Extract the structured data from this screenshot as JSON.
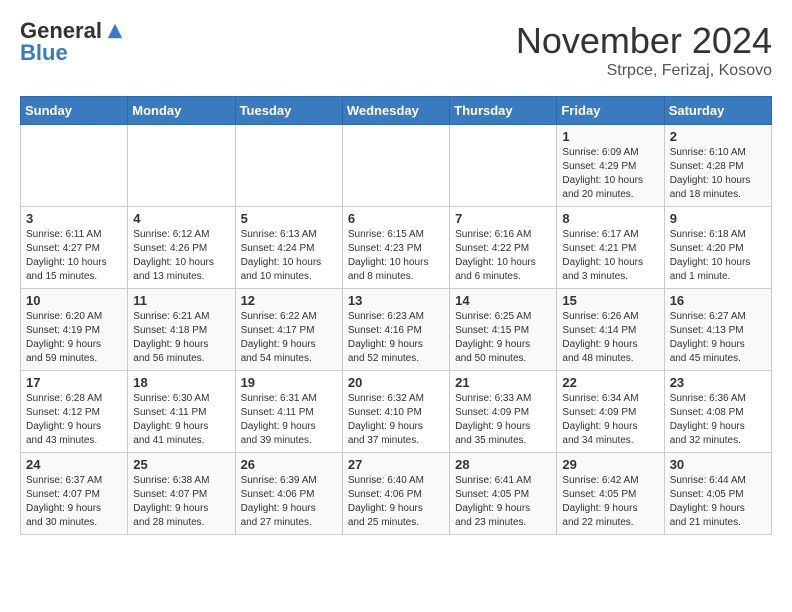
{
  "header": {
    "logo_general": "General",
    "logo_blue": "Blue",
    "month_title": "November 2024",
    "location": "Strpce, Ferizaj, Kosovo"
  },
  "weekdays": [
    "Sunday",
    "Monday",
    "Tuesday",
    "Wednesday",
    "Thursday",
    "Friday",
    "Saturday"
  ],
  "weeks": [
    [
      {
        "day": "",
        "info": ""
      },
      {
        "day": "",
        "info": ""
      },
      {
        "day": "",
        "info": ""
      },
      {
        "day": "",
        "info": ""
      },
      {
        "day": "",
        "info": ""
      },
      {
        "day": "1",
        "info": "Sunrise: 6:09 AM\nSunset: 4:29 PM\nDaylight: 10 hours\nand 20 minutes."
      },
      {
        "day": "2",
        "info": "Sunrise: 6:10 AM\nSunset: 4:28 PM\nDaylight: 10 hours\nand 18 minutes."
      }
    ],
    [
      {
        "day": "3",
        "info": "Sunrise: 6:11 AM\nSunset: 4:27 PM\nDaylight: 10 hours\nand 15 minutes."
      },
      {
        "day": "4",
        "info": "Sunrise: 6:12 AM\nSunset: 4:26 PM\nDaylight: 10 hours\nand 13 minutes."
      },
      {
        "day": "5",
        "info": "Sunrise: 6:13 AM\nSunset: 4:24 PM\nDaylight: 10 hours\nand 10 minutes."
      },
      {
        "day": "6",
        "info": "Sunrise: 6:15 AM\nSunset: 4:23 PM\nDaylight: 10 hours\nand 8 minutes."
      },
      {
        "day": "7",
        "info": "Sunrise: 6:16 AM\nSunset: 4:22 PM\nDaylight: 10 hours\nand 6 minutes."
      },
      {
        "day": "8",
        "info": "Sunrise: 6:17 AM\nSunset: 4:21 PM\nDaylight: 10 hours\nand 3 minutes."
      },
      {
        "day": "9",
        "info": "Sunrise: 6:18 AM\nSunset: 4:20 PM\nDaylight: 10 hours\nand 1 minute."
      }
    ],
    [
      {
        "day": "10",
        "info": "Sunrise: 6:20 AM\nSunset: 4:19 PM\nDaylight: 9 hours\nand 59 minutes."
      },
      {
        "day": "11",
        "info": "Sunrise: 6:21 AM\nSunset: 4:18 PM\nDaylight: 9 hours\nand 56 minutes."
      },
      {
        "day": "12",
        "info": "Sunrise: 6:22 AM\nSunset: 4:17 PM\nDaylight: 9 hours\nand 54 minutes."
      },
      {
        "day": "13",
        "info": "Sunrise: 6:23 AM\nSunset: 4:16 PM\nDaylight: 9 hours\nand 52 minutes."
      },
      {
        "day": "14",
        "info": "Sunrise: 6:25 AM\nSunset: 4:15 PM\nDaylight: 9 hours\nand 50 minutes."
      },
      {
        "day": "15",
        "info": "Sunrise: 6:26 AM\nSunset: 4:14 PM\nDaylight: 9 hours\nand 48 minutes."
      },
      {
        "day": "16",
        "info": "Sunrise: 6:27 AM\nSunset: 4:13 PM\nDaylight: 9 hours\nand 45 minutes."
      }
    ],
    [
      {
        "day": "17",
        "info": "Sunrise: 6:28 AM\nSunset: 4:12 PM\nDaylight: 9 hours\nand 43 minutes."
      },
      {
        "day": "18",
        "info": "Sunrise: 6:30 AM\nSunset: 4:11 PM\nDaylight: 9 hours\nand 41 minutes."
      },
      {
        "day": "19",
        "info": "Sunrise: 6:31 AM\nSunset: 4:11 PM\nDaylight: 9 hours\nand 39 minutes."
      },
      {
        "day": "20",
        "info": "Sunrise: 6:32 AM\nSunset: 4:10 PM\nDaylight: 9 hours\nand 37 minutes."
      },
      {
        "day": "21",
        "info": "Sunrise: 6:33 AM\nSunset: 4:09 PM\nDaylight: 9 hours\nand 35 minutes."
      },
      {
        "day": "22",
        "info": "Sunrise: 6:34 AM\nSunset: 4:09 PM\nDaylight: 9 hours\nand 34 minutes."
      },
      {
        "day": "23",
        "info": "Sunrise: 6:36 AM\nSunset: 4:08 PM\nDaylight: 9 hours\nand 32 minutes."
      }
    ],
    [
      {
        "day": "24",
        "info": "Sunrise: 6:37 AM\nSunset: 4:07 PM\nDaylight: 9 hours\nand 30 minutes."
      },
      {
        "day": "25",
        "info": "Sunrise: 6:38 AM\nSunset: 4:07 PM\nDaylight: 9 hours\nand 28 minutes."
      },
      {
        "day": "26",
        "info": "Sunrise: 6:39 AM\nSunset: 4:06 PM\nDaylight: 9 hours\nand 27 minutes."
      },
      {
        "day": "27",
        "info": "Sunrise: 6:40 AM\nSunset: 4:06 PM\nDaylight: 9 hours\nand 25 minutes."
      },
      {
        "day": "28",
        "info": "Sunrise: 6:41 AM\nSunset: 4:05 PM\nDaylight: 9 hours\nand 23 minutes."
      },
      {
        "day": "29",
        "info": "Sunrise: 6:42 AM\nSunset: 4:05 PM\nDaylight: 9 hours\nand 22 minutes."
      },
      {
        "day": "30",
        "info": "Sunrise: 6:44 AM\nSunset: 4:05 PM\nDaylight: 9 hours\nand 21 minutes."
      }
    ]
  ]
}
